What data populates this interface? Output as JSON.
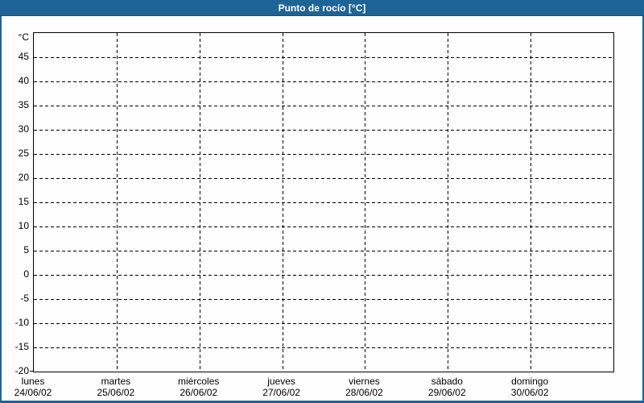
{
  "window": {
    "title": "Punto de rocío [°C]"
  },
  "colors": {
    "frame_blue": "#1E6496",
    "frame_blue_dark": "#174F79",
    "canvas_bg": "#FDFEFD",
    "grid": "#000000",
    "text": "#000000",
    "title_text": "#FFFFFF"
  },
  "chart_data": {
    "type": "line",
    "title": "Punto de rocío [°C]",
    "xlabel": "",
    "ylabel": "°C",
    "ylim": [
      -20,
      50
    ],
    "grid": {
      "style": "dashed",
      "horizontal": true,
      "vertical": true
    },
    "legend": "none",
    "y_axis": {
      "unit_label": "°C",
      "min": -20,
      "max": 50,
      "tick_step": 5,
      "tick_labels": [
        45,
        40,
        35,
        30,
        25,
        20,
        15,
        10,
        5,
        0,
        -5,
        -10,
        -15,
        -20
      ]
    },
    "x_axis": {
      "interval_count": 7,
      "days": [
        {
          "label": "lunes",
          "date": "24/06/02"
        },
        {
          "label": "martes",
          "date": "25/06/02"
        },
        {
          "label": "miércoles",
          "date": "26/06/02"
        },
        {
          "label": "jueves",
          "date": "27/06/02"
        },
        {
          "label": "viernes",
          "date": "28/06/02"
        },
        {
          "label": "sábado",
          "date": "29/06/02"
        },
        {
          "label": "domingo",
          "date": "30/06/02"
        }
      ]
    },
    "series": []
  }
}
